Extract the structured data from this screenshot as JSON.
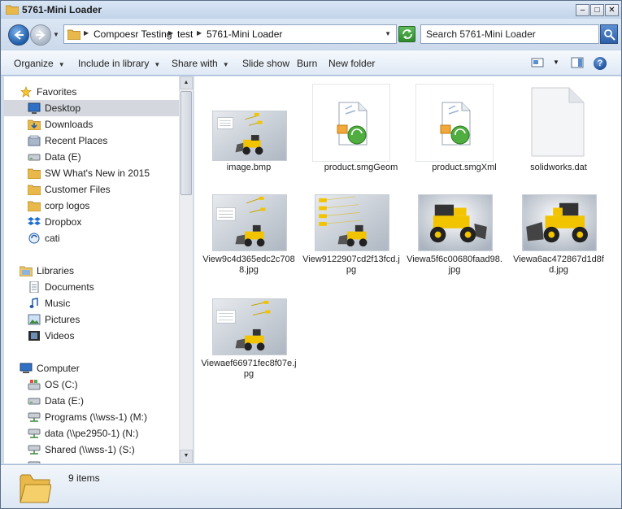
{
  "window": {
    "title": "5761-Mini Loader"
  },
  "window_controls": {
    "minimize": "–",
    "maximize": "□",
    "close": "✕"
  },
  "address": {
    "crumbs": [
      "Compoesr Testing",
      "test",
      "5761-Mini Loader"
    ],
    "separator": "▶",
    "dropdown": "▼",
    "history": "▼"
  },
  "search": {
    "placeholder": "Search 5761-Mini Loader"
  },
  "toolbar": {
    "organize": "Organize",
    "include": "Include in library",
    "share": "Share with",
    "slideshow": "Slide show",
    "burn": "Burn",
    "new_folder": "New folder",
    "caret": "▼",
    "help": "?"
  },
  "nav": {
    "favorites_header": "Favorites",
    "favorites": [
      "Desktop",
      "Downloads",
      "Recent Places",
      "Data (E)",
      "SW What's New in 2015",
      "Customer Files",
      "corp logos",
      "Dropbox",
      "cati"
    ],
    "libraries_header": "Libraries",
    "libraries": [
      "Documents",
      "Music",
      "Pictures",
      "Videos"
    ],
    "computer_header": "Computer",
    "computer": [
      "OS (C:)",
      "Data (E:)",
      "Programs (\\\\wss-1) (M:)",
      "data (\\\\pe2950-1) (N:)",
      "Shared (\\\\wss-1) (S:)"
    ]
  },
  "scroll": {
    "up": "▲",
    "down": "▼"
  },
  "files": [
    {
      "name": "image.bmp",
      "kind": "render"
    },
    {
      "name": "product.smgGeom",
      "kind": "doc"
    },
    {
      "name": "product.smgXml",
      "kind": "doc"
    },
    {
      "name": "solidworks.dat",
      "kind": "blank"
    },
    {
      "name": "View9c4d365edc2c7088.jpg",
      "kind": "render"
    },
    {
      "name": "View9122907cd2f13fcd.jpg",
      "kind": "render2"
    },
    {
      "name": "Viewa5f6c00680faad98.jpg",
      "kind": "loader"
    },
    {
      "name": "Viewa6ac472867d1d8fd.jpg",
      "kind": "loader2"
    },
    {
      "name": "Viewaef66971fec8f07e.jpg",
      "kind": "render"
    }
  ],
  "status": {
    "count": "9 items"
  },
  "colors": {
    "accent": "#1f5ba8",
    "loader_yellow": "#f2c400",
    "selection": "#d4d8de"
  }
}
